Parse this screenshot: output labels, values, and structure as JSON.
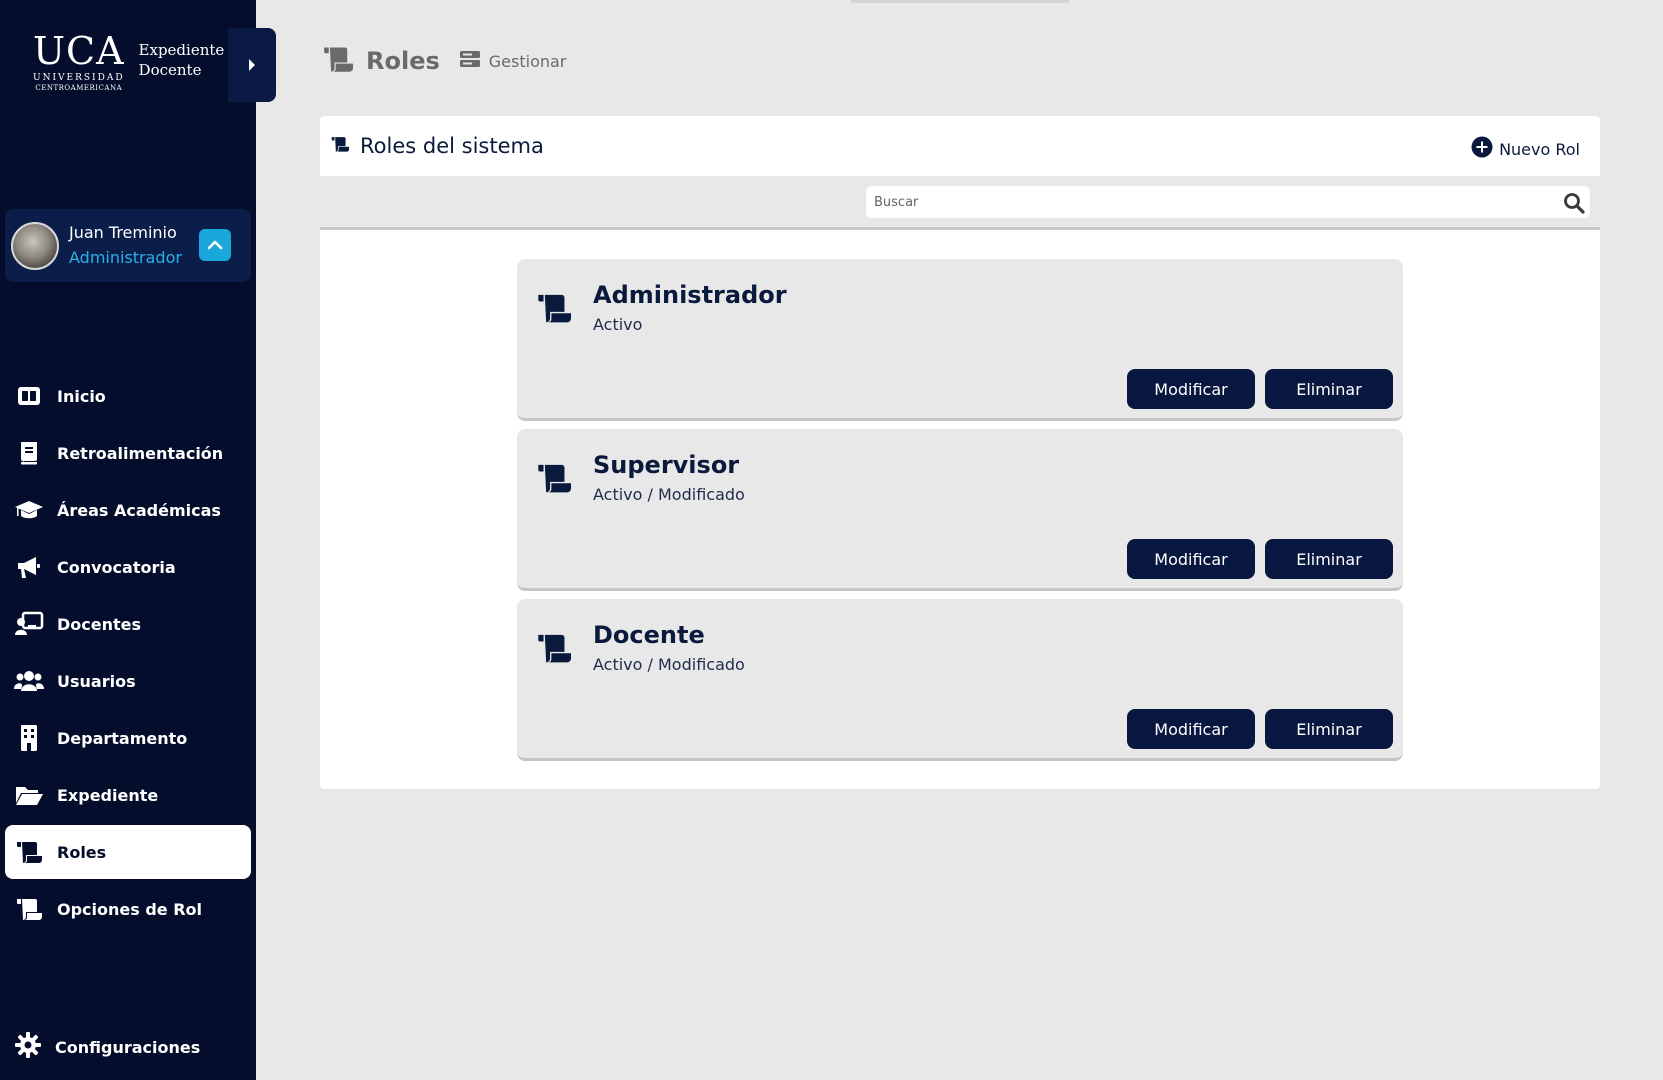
{
  "brand": {
    "logo_main": "UCA",
    "logo_sub1": "UNIVERSIDAD",
    "logo_sub2": "CENTROAMERICANA",
    "app_line1": "Expediente",
    "app_line2": "Docente"
  },
  "user": {
    "name": "Juan Treminio",
    "role": "Administrador"
  },
  "nav": {
    "items": [
      {
        "label": "Inicio",
        "icon": "dashboard-icon"
      },
      {
        "label": "Retroalimentación",
        "icon": "book-icon"
      },
      {
        "label": "Áreas Académicas",
        "icon": "graduation-cap-icon"
      },
      {
        "label": "Convocatoria",
        "icon": "megaphone-icon"
      },
      {
        "label": "Docentes",
        "icon": "teacher-icon"
      },
      {
        "label": "Usuarios",
        "icon": "users-icon"
      },
      {
        "label": "Departamento",
        "icon": "building-icon"
      },
      {
        "label": "Expediente",
        "icon": "folder-open-icon"
      },
      {
        "label": "Roles",
        "icon": "scroll-icon",
        "active": true
      },
      {
        "label": "Opciones de Rol",
        "icon": "scroll-icon"
      }
    ],
    "settings_label": "Configuraciones"
  },
  "header": {
    "title": "Roles",
    "breadcrumb": "Gestionar"
  },
  "panel": {
    "title": "Roles del sistema",
    "new_button": "Nuevo Rol",
    "search_placeholder": "Buscar"
  },
  "roles": [
    {
      "name": "Administrador",
      "status": "Activo",
      "edit_label": "Modificar",
      "delete_label": "Eliminar"
    },
    {
      "name": "Supervisor",
      "status": "Activo / Modificado",
      "edit_label": "Modificar",
      "delete_label": "Eliminar"
    },
    {
      "name": "Docente",
      "status": "Activo / Modificado",
      "edit_label": "Modificar",
      "delete_label": "Eliminar"
    }
  ],
  "colors": {
    "sidebar": "#040e2c",
    "accent": "#1aa7dc",
    "button": "#08173f",
    "background": "#e8e8e8"
  }
}
